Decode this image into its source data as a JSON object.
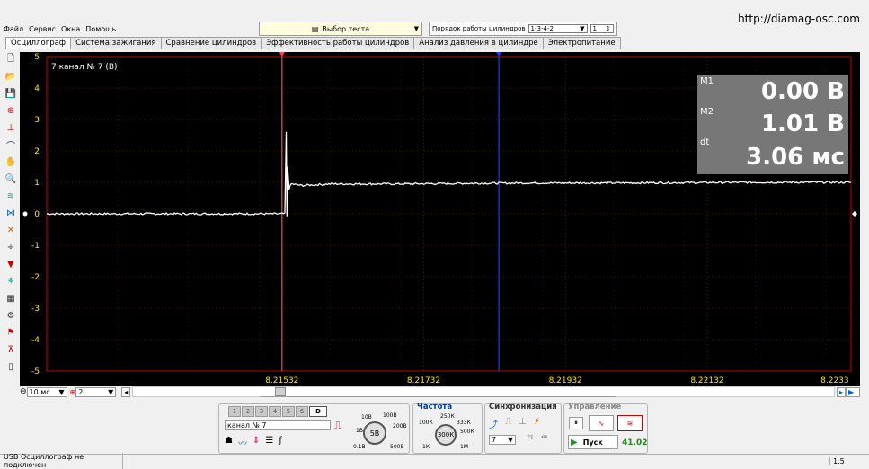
{
  "menu": [
    "Файл",
    "Сервис",
    "Окна",
    "Помощь"
  ],
  "url": "http://diamag-osc.com",
  "test_select": {
    "label": "Выбор теста"
  },
  "cyl_order": {
    "label": "Порядок работы цилиндров",
    "value": "1-3-4-2",
    "num": "1"
  },
  "tabs": [
    "Осциллограф",
    "Система зажигания",
    "Сравнение цилиндров",
    "Эффективность работы цилиндров",
    "Анализ давления в цилиндре",
    "Электропитание"
  ],
  "channel_label": "7  канал № 7 (В)",
  "measurements": {
    "m1_label": "M1",
    "m1_value": "0.00 В",
    "m2_label": "M2",
    "m2_value": "1.01 В",
    "dt_label": "dt",
    "dt_value": "3.06 мс"
  },
  "chart_data": {
    "type": "line",
    "title": "",
    "y_ticks": [
      "5",
      "4",
      "3",
      "2",
      "1",
      "0",
      "-1",
      "-2",
      "-3",
      "-4",
      "-5"
    ],
    "ylim": [
      -5,
      5
    ],
    "x_ticks": [
      "8.21532",
      "8.21732",
      "8.21932",
      "8.22132",
      "8.2233"
    ],
    "grid": true,
    "series": [
      {
        "color": "#ffffff",
        "x": [
          8.212,
          8.21536,
          8.21538,
          8.21539,
          8.2154,
          8.21542,
          8.21545,
          8.2156,
          8.216,
          8.217,
          8.218,
          8.219,
          8.22,
          8.221,
          8.222,
          8.223,
          8.22335
        ],
        "y": [
          0,
          0,
          2.6,
          -0.1,
          1.5,
          0.8,
          0.95,
          0.9,
          0.95,
          0.95,
          0.97,
          0.98,
          0.98,
          0.99,
          1.0,
          1.0,
          1.0
        ]
      }
    ],
    "cursor_1": {
      "x": 8.21532,
      "color": "#ff4060"
    },
    "cursor_2": {
      "x": 8.21838,
      "color": "#1a3cff"
    }
  },
  "timebase": {
    "value": "10 мс",
    "zoom": "2"
  },
  "channels": [
    "1",
    "2",
    "3",
    "4",
    "5",
    "6",
    "D"
  ],
  "channel_name": "канал № 7",
  "range_knob": {
    "labels": [
      "10В",
      "100В",
      "200В",
      "500В",
      "0.1В",
      "1В"
    ],
    "value": "5В"
  },
  "freq": {
    "title": "Частота",
    "labels": [
      "100К",
      "250К",
      "333К",
      "500К",
      "1М",
      "1К"
    ],
    "value": "300К"
  },
  "sync": {
    "title": "Синхронизация",
    "value": "7"
  },
  "control": {
    "title": "Управление",
    "start": "Пуск",
    "counter": "41.02"
  },
  "status": {
    "left": "USB Осциллограф не подключен",
    "right": "1.5"
  }
}
